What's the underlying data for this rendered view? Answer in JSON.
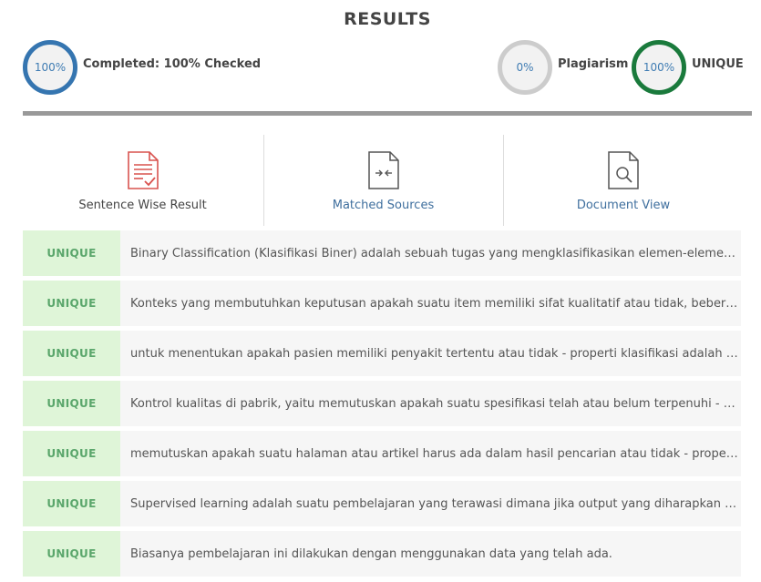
{
  "header": {
    "title": "RESULTS"
  },
  "stats": {
    "completed": {
      "value": "100%",
      "label": "Completed: 100% Checked"
    },
    "plagiarism": {
      "value": "0%",
      "label": "Plagiarism"
    },
    "unique": {
      "value": "100%",
      "label": "UNIQUE"
    }
  },
  "tabs": [
    {
      "label": "Sentence Wise Result",
      "icon": "document-check-icon"
    },
    {
      "label": "Matched Sources",
      "icon": "document-compare-icon"
    },
    {
      "label": "Document View",
      "icon": "document-search-icon"
    }
  ],
  "colors": {
    "completed_ring": "#3575b0",
    "plagiarism_ring": "#cccccc",
    "unique_ring": "#1a7a3c",
    "badge_bg": "#dff5d8",
    "badge_text": "#5aa66b",
    "icon_red": "#d9534f"
  },
  "results": [
    {
      "status": "UNIQUE",
      "text": "Binary Classification (Klasifikasi Biner) adalah sebuah tugas yang mengklasifikasikan elemen-elemen ..."
    },
    {
      "status": "UNIQUE",
      "text": "Konteks yang membutuhkan keputusan apakah suatu item memiliki sifat kualitatif atau tidak, beberap..."
    },
    {
      "status": "UNIQUE",
      "text": "untuk menentukan apakah pasien memiliki penyakit tertentu atau tidak - properti klasifikasi adalah ke..."
    },
    {
      "status": "UNIQUE",
      "text": "Kontrol kualitas di pabrik, yaitu memutuskan apakah suatu spesifikasi telah atau belum terpenuhi - kl..."
    },
    {
      "status": "UNIQUE",
      "text": "memutuskan apakah suatu halaman atau artikel harus ada dalam hasil pencarian atau tidak - properti..."
    },
    {
      "status": "UNIQUE",
      "text": "Supervised learning adalah suatu pembelajaran yang terawasi dimana jika output yang diharapkan te..."
    },
    {
      "status": "UNIQUE",
      "text": "Biasanya pembelajaran ini dilakukan dengan menggunakan data yang telah ada."
    }
  ]
}
